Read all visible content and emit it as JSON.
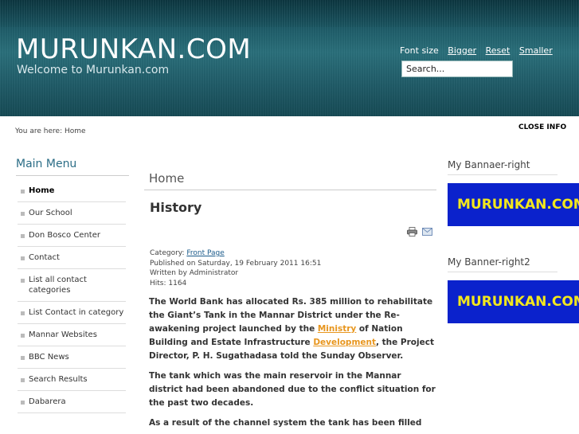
{
  "header": {
    "site_title": "MURUNKAN.COM",
    "tagline": "Welcome to Murunkan.com",
    "font_size_label": "Font size",
    "bigger": "Bigger",
    "reset": "Reset",
    "smaller": "Smaller",
    "search_value": "Search..."
  },
  "breadcrumb": "You are here: Home",
  "close_info": "CLOSE INFO",
  "menu": {
    "title": "Main Menu",
    "items": [
      {
        "label": "Home"
      },
      {
        "label": "Our School"
      },
      {
        "label": "Don Bosco Center"
      },
      {
        "label": "Contact"
      },
      {
        "label": "List all contact categories"
      },
      {
        "label": "List Contact in category"
      },
      {
        "label": "Mannar Websites"
      },
      {
        "label": "BBC News"
      },
      {
        "label": "Search Results"
      },
      {
        "label": "Dabarera"
      }
    ]
  },
  "main": {
    "heading": "Home",
    "article_title": "History",
    "category_label": "Category: ",
    "category_link": "Front Page",
    "published": "Published on Saturday, 19 February 2011 16:51",
    "written_by": "Written by Administrator",
    "hits": "Hits: 1164",
    "p1_a": "The World Bank has allocated Rs. 385 million to rehabilitate the Giant’s Tank in the Mannar District under the Re-awakening project launched by the ",
    "p1_link1": "Ministry",
    "p1_b": " of Nation Building and Estate Infrastructure ",
    "p1_link2": "Development",
    "p1_c": ", the Project Director, P. H. Sugathadasa told the Sunday Observer.",
    "p2": "The tank which was the main reservoir in the Mannar district had been abandoned due to the conflict situation for the past two decades.",
    "p3": "As a result of the channel system the tank has been filled"
  },
  "right": {
    "title1": "My Bannaer-right",
    "banner1": "MURUNKAN.COM",
    "title2": "My Banner-right2",
    "banner2": "MURUNKAN.COM"
  },
  "colors": {
    "header_bg": "#1d5a66",
    "menu_title": "#2b6d86",
    "banner_bg": "#0b22cc",
    "banner_text": "#f3e81c",
    "link_orange": "#e8961e"
  }
}
